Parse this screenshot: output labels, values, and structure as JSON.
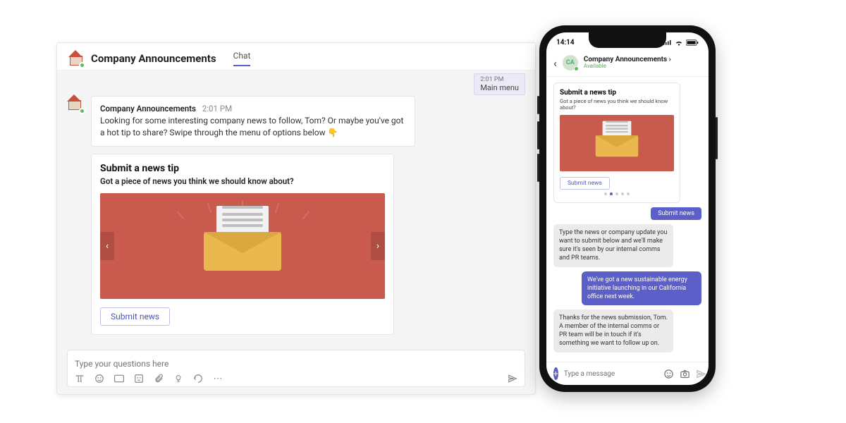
{
  "desktop": {
    "header": {
      "title": "Company Announcements",
      "tab": "Chat"
    },
    "menu_chip": {
      "time": "2:01 PM",
      "label": "Main menu"
    },
    "message": {
      "from": "Company Announcements",
      "time": "2:01 PM",
      "text": "Looking for some interesting company news to follow, Tom? Or maybe you've got a hot tip to share? Swipe through the menu of options below 👇"
    },
    "card": {
      "title": "Submit a news tip",
      "subtitle": "Got a piece of news you think we should know about?",
      "cta": "Submit news"
    },
    "composer": {
      "placeholder": "Type your questions here"
    }
  },
  "mobile": {
    "status": {
      "time": "14:14"
    },
    "header": {
      "initials": "CA",
      "title": "Company Announcements ›",
      "status": "Available"
    },
    "card": {
      "title": "Submit a news tip",
      "subtitle": "Got a piece of news you think we should know about?",
      "cta": "Submit news"
    },
    "chat": [
      {
        "role": "user_pill",
        "text": "Submit news"
      },
      {
        "role": "bot",
        "text": "Type the news or company update you want to submit below and we'll make sure it's seen by our internal comms and PR teams."
      },
      {
        "role": "user",
        "text": "We've got a new sustainable energy initiative launching in our California office next week."
      },
      {
        "role": "bot",
        "text": "Thanks for the news submission, Tom. A member of the internal comms or PR team will be in touch if it's something we want to follow up on."
      }
    ],
    "composer": {
      "placeholder": "Type a message"
    }
  }
}
